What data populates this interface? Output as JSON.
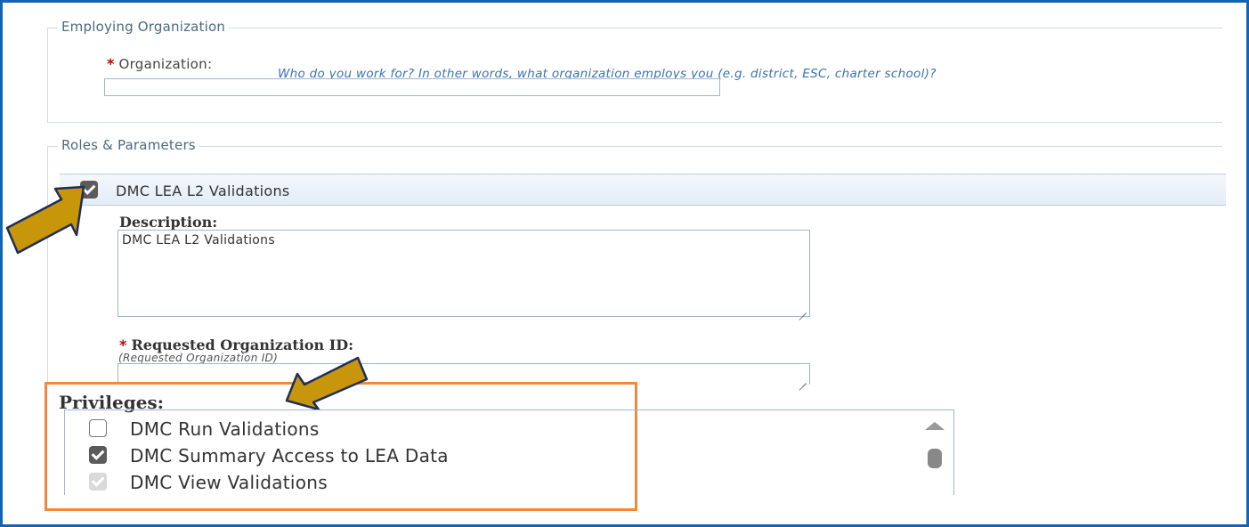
{
  "employing": {
    "legend": "Employing Organization",
    "required_mark": "*",
    "org_label": "Organization:",
    "org_hint": "Who do you work for? In other words, what organization employs you (e.g. district, ESC, charter school)?",
    "org_value": ""
  },
  "roles": {
    "legend": "Roles & Parameters",
    "role_title": "DMC LEA L2 Validations",
    "role_checked": true,
    "description_label": "Description:",
    "description_value": "DMC LEA L2 Validations",
    "required_mark": "*",
    "req_org_label": "Requested Organization ID:",
    "req_org_hint": "(Requested Organization ID)",
    "req_org_value": ""
  },
  "privileges": {
    "title": "Privileges:",
    "items": [
      {
        "label": "DMC Run Validations",
        "state": "unchecked"
      },
      {
        "label": "DMC Summary Access to LEA Data",
        "state": "checked"
      },
      {
        "label": "DMC View Validations",
        "state": "checked-disabled"
      }
    ]
  },
  "colors": {
    "frame_border": "#1464b4",
    "highlight_border": "#ef8a3c",
    "annotation_arrow": "#c8960a",
    "required": "#c00000",
    "hint_text": "#3a72b0"
  }
}
